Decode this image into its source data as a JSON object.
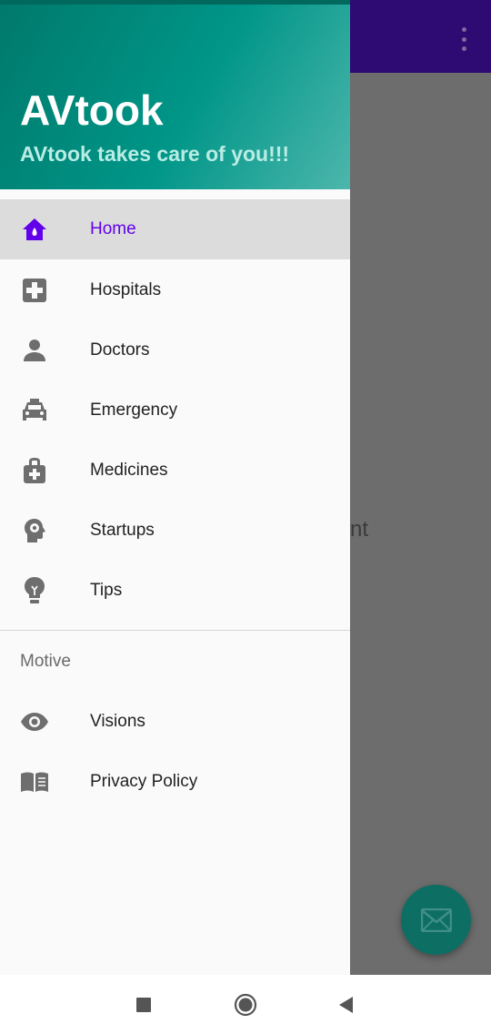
{
  "app": {
    "background_text": "nt",
    "colors": {
      "toolbar": "#2e0a73",
      "fab": "#0d6e63",
      "accent": "#6200ea",
      "header_gradient_start": "#00796b",
      "header_gradient_end": "#4db6ac"
    }
  },
  "drawer": {
    "title": "AVtook",
    "subtitle": "AVtook takes care of you!!!",
    "items": [
      {
        "label": "Home",
        "icon": "home-icon",
        "active": true
      },
      {
        "label": "Hospitals",
        "icon": "hospital-icon"
      },
      {
        "label": "Doctors",
        "icon": "person-icon"
      },
      {
        "label": "Emergency",
        "icon": "taxi-icon"
      },
      {
        "label": "Medicines",
        "icon": "medical-bag-icon"
      },
      {
        "label": "Startups",
        "icon": "brain-gear-icon"
      },
      {
        "label": "Tips",
        "icon": "lightbulb-icon"
      }
    ],
    "section": {
      "title": "Motive",
      "items": [
        {
          "label": "Visions",
          "icon": "eye-icon"
        },
        {
          "label": "Privacy Policy",
          "icon": "book-icon"
        }
      ]
    }
  },
  "navbar": {
    "buttons": [
      {
        "name": "recents",
        "icon": "square-icon"
      },
      {
        "name": "home",
        "icon": "circle-icon"
      },
      {
        "name": "back",
        "icon": "triangle-back-icon"
      }
    ]
  }
}
